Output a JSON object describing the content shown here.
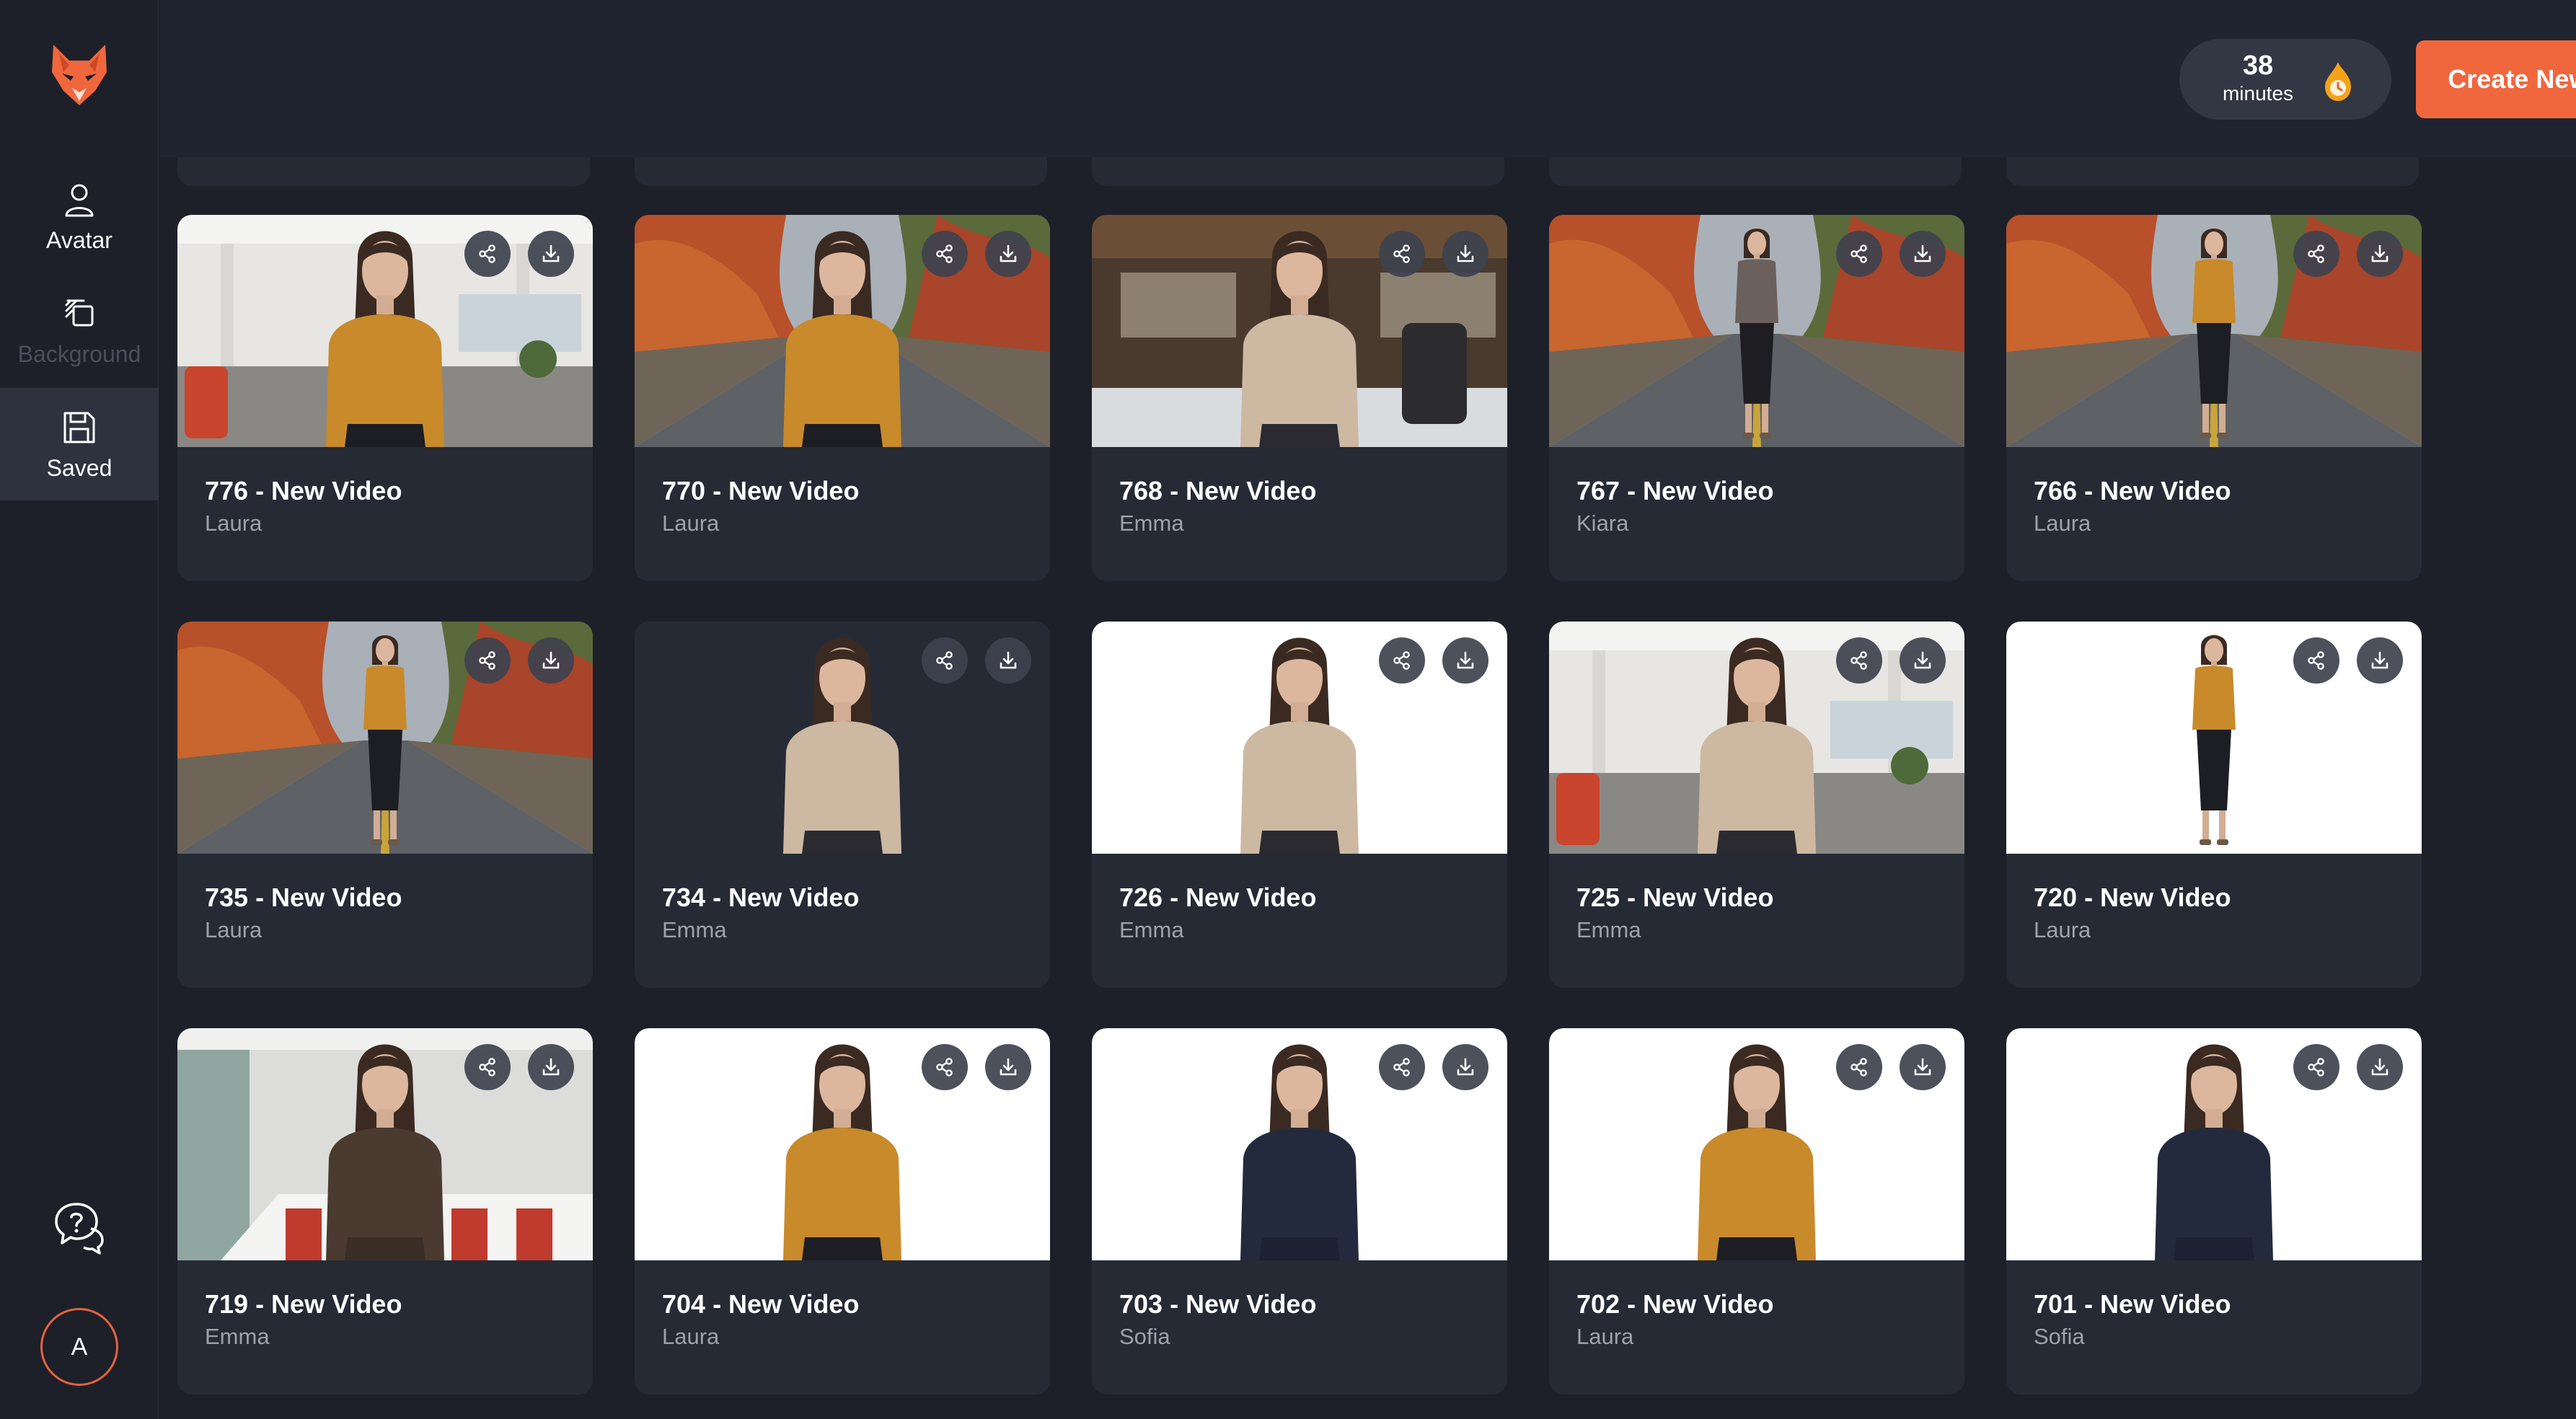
{
  "sidebar": {
    "nav": [
      {
        "label": "Avatar",
        "icon": "user-icon",
        "state": "normal"
      },
      {
        "label": "Background",
        "icon": "layers-icon",
        "state": "disabled"
      },
      {
        "label": "Saved",
        "icon": "save-icon",
        "state": "active"
      }
    ],
    "user_initial": "A"
  },
  "header": {
    "minutes_value": "38",
    "minutes_unit": "minutes",
    "create_label": "Create New Video"
  },
  "colors": {
    "accent": "#f0673e",
    "bg": "#1d2029",
    "card": "#252a35",
    "muted": "#9da2ad"
  },
  "videos": [
    {
      "title": "776 - New Video",
      "avatar": "Laura",
      "scene": "office",
      "outfit": "mustard",
      "framing": "mid"
    },
    {
      "title": "770 - New Video",
      "avatar": "Laura",
      "scene": "autumn",
      "outfit": "mustard",
      "framing": "mid"
    },
    {
      "title": "768 - New Video",
      "avatar": "Emma",
      "scene": "loft",
      "outfit": "beige",
      "framing": "mid"
    },
    {
      "title": "767 - New Video",
      "avatar": "Kiara",
      "scene": "autumn",
      "outfit": "gray",
      "framing": "full"
    },
    {
      "title": "766 - New Video",
      "avatar": "Laura",
      "scene": "autumn",
      "outfit": "mustard",
      "framing": "full"
    },
    {
      "title": "735 - New Video",
      "avatar": "Laura",
      "scene": "autumn",
      "outfit": "mustard",
      "framing": "full"
    },
    {
      "title": "734 - New Video",
      "avatar": "Emma",
      "scene": "dark",
      "outfit": "beige",
      "framing": "mid"
    },
    {
      "title": "726 - New Video",
      "avatar": "Emma",
      "scene": "white",
      "outfit": "beige",
      "framing": "mid"
    },
    {
      "title": "725 - New Video",
      "avatar": "Emma",
      "scene": "office",
      "outfit": "beige",
      "framing": "mid"
    },
    {
      "title": "720 - New Video",
      "avatar": "Laura",
      "scene": "white",
      "outfit": "mustard",
      "framing": "full"
    },
    {
      "title": "719 - New Video",
      "avatar": "Emma",
      "scene": "meeting",
      "outfit": "brown",
      "framing": "mid"
    },
    {
      "title": "704 - New Video",
      "avatar": "Laura",
      "scene": "white",
      "outfit": "mustard",
      "framing": "mid"
    },
    {
      "title": "703 - New Video",
      "avatar": "Sofia",
      "scene": "white",
      "outfit": "navy",
      "framing": "mid"
    },
    {
      "title": "702 - New Video",
      "avatar": "Laura",
      "scene": "white",
      "outfit": "mustard",
      "framing": "mid"
    },
    {
      "title": "701 - New Video",
      "avatar": "Sofia",
      "scene": "white",
      "outfit": "navy",
      "framing": "mid"
    }
  ]
}
